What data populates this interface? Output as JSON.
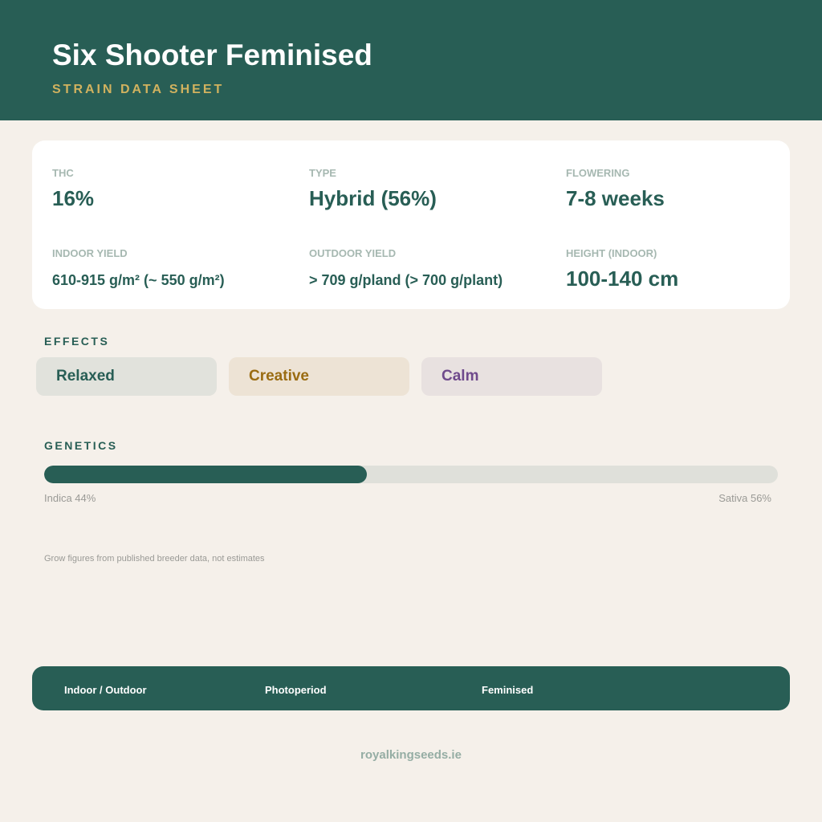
{
  "header": {
    "title": "Six Shooter Feminised",
    "subtitle": "STRAIN DATA SHEET"
  },
  "stats": {
    "thc": {
      "label": "THC",
      "value": "16%"
    },
    "type": {
      "label": "TYPE",
      "value": "Hybrid (56%)"
    },
    "flowering": {
      "label": "FLOWERING",
      "value": "7-8 weeks"
    },
    "indoor_yield": {
      "label": "INDOOR YIELD",
      "value": "610-915 g/m² (~ 550 g/m²)"
    },
    "outdoor_yield": {
      "label": "OUTDOOR YIELD",
      "value": "> 709 g/pland (> 700 g/plant)"
    },
    "height_indoor": {
      "label": "HEIGHT (INDOOR)",
      "value": "100-140 cm"
    }
  },
  "effects": {
    "heading": "EFFECTS",
    "items": [
      {
        "label": "Relaxed",
        "color": "#285e55",
        "background": "#e1e2dc"
      },
      {
        "label": "Creative",
        "color": "#9a6c12",
        "background": "#ede3d5"
      },
      {
        "label": "Calm",
        "color": "#6f4a8c",
        "background": "#e8e1e0"
      }
    ]
  },
  "genetics": {
    "heading": "GENETICS",
    "indica_label": "Indica 44%",
    "sativa_label": "Sativa 56%",
    "indica_percent": 44,
    "sativa_percent": 56
  },
  "footnote": "Grow figures from published breeder data, not estimates",
  "footer": {
    "items": [
      "Indoor / Outdoor",
      "Photoperiod",
      "Feminised"
    ]
  },
  "site": "royalkingseeds.ie",
  "colors": {
    "primary": "#285e55",
    "accent": "#d1b25f",
    "background": "#f5f0ea",
    "muted": "#a6b8b1"
  }
}
